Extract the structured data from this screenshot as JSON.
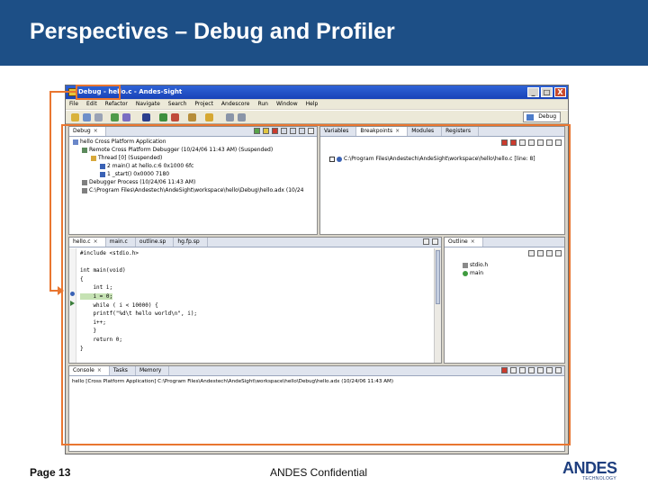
{
  "slide": {
    "title": "Perspectives – Debug and Profiler",
    "footer_page": "Page 13",
    "footer_confidential": "ANDES Confidential",
    "logo_text": "ANDES",
    "logo_subtext": "TECHNOLOGY",
    "accent_color": "#e97630",
    "title_bar_color": "#1d4f86"
  },
  "window": {
    "title": "Debug - hello.c - Andes-Sight",
    "controls": {
      "minimize": "_",
      "maximize": "□",
      "close": "X"
    },
    "menu": [
      "File",
      "Edit",
      "Refactor",
      "Navigate",
      "Search",
      "Project",
      "Andescore",
      "Run",
      "Window",
      "Help"
    ],
    "perspective_button": "Debug"
  },
  "debug_view": {
    "tab": "Debug",
    "tree": [
      "hello Cross Platform Application",
      "Remote Cross Platform Debugger (10/24/06 11:43 AM) (Suspended)",
      "Thread [0] (Suspended)",
      "2 main() at hello.c:6 0x1000 6fc",
      "1 _start() 0x0000 7180",
      "Debugger Process (10/24/06 11:43 AM)",
      "C:\\Program Files\\Andestech\\AndeSight\\workspace\\hello\\Debug\\hello.adx (10/24"
    ]
  },
  "breakpoints_view": {
    "tabs": [
      "Variables",
      "Breakpoints",
      "Modules",
      "Registers"
    ],
    "entries": [
      "C:\\Program Files\\Andestech\\AndeSight\\workspace\\hello\\hello.c [line: 8]"
    ]
  },
  "editor": {
    "tabs": [
      "hello.c",
      "main.c",
      "outline.sp",
      "hg.fp.sp"
    ],
    "lines": [
      "#include <stdio.h>",
      "",
      "int main(void)",
      "{",
      "    int i;",
      "    i = 0;",
      "    while ( i < 10000) {",
      "    printf(\"%d\\t hello world\\n\", i);",
      "    i++;",
      "    }",
      "    return 0;",
      "}"
    ]
  },
  "outline_view": {
    "tab": "Outline",
    "items": [
      "stdio.h",
      "main"
    ]
  },
  "console_view": {
    "tabs": [
      "Console",
      "Tasks",
      "Memory"
    ],
    "text": "hello [Cross Platform Application] C:\\Program Files\\Andestech\\AndeSight\\workspace\\hello\\Debug\\hello.adx (10/24/06 11:43 AM)"
  }
}
